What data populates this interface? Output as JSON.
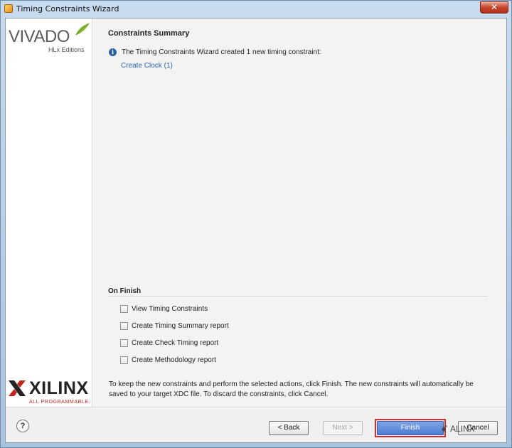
{
  "window": {
    "title": "Timing Constraints Wizard",
    "close_glyph": "✕"
  },
  "brand": {
    "product": "VIVADO",
    "edition": "HLx Editions",
    "company": "XILINX",
    "tagline": "ALL PROGRAMMABLE."
  },
  "summary": {
    "title": "Constraints Summary",
    "info_icon": "info-icon",
    "message": "The Timing Constraints Wizard created 1 new timing constraint:",
    "link": "Create Clock (1)"
  },
  "on_finish": {
    "label": "On Finish",
    "options": [
      {
        "label": "View Timing Constraints",
        "checked": false
      },
      {
        "label": "Create Timing Summary report",
        "checked": false
      },
      {
        "label": "Create Check Timing report",
        "checked": false
      },
      {
        "label": "Create Methodology report",
        "checked": false
      }
    ]
  },
  "note": "To keep the new constraints and perform the selected actions, click Finish. The new constraints will automatically be saved to your target XDC file. To discard the constraints, click Cancel.",
  "footer": {
    "help": "?",
    "back": "< Back",
    "next": "Next >",
    "finish": "Finish",
    "cancel": "Cancel",
    "watermark": "ALINX"
  },
  "colors": {
    "link": "#2a64b8",
    "finish_button": "#4d7cd0",
    "highlight_outline": "#d42b2b",
    "xilinx_red": "#c0261c"
  }
}
